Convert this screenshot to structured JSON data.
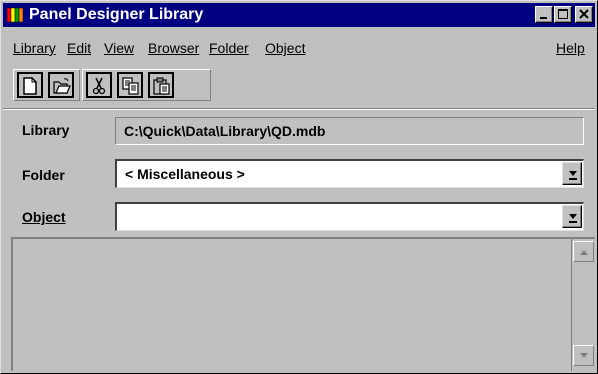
{
  "window": {
    "title": "Panel Designer Library",
    "titlebar_color": "#000080",
    "icon": "app-books-icon",
    "controls": [
      "minimize-icon",
      "maximize-icon",
      "close-icon"
    ]
  },
  "menu": {
    "items": [
      {
        "label": "Library"
      },
      {
        "label": "Edit"
      },
      {
        "label": "View"
      },
      {
        "label": "Browser"
      },
      {
        "label": "Folder"
      },
      {
        "label": "Object"
      }
    ],
    "help": "Help"
  },
  "toolbar": {
    "buttons": [
      {
        "icon": "new-document-icon"
      },
      {
        "icon": "open-folder-icon"
      },
      {
        "icon": "cut-icon"
      },
      {
        "icon": "copy-icon"
      },
      {
        "icon": "paste-icon"
      }
    ]
  },
  "form": {
    "library_label": "Library",
    "library_value": "C:\\Quick\\Data\\Library\\QD.mdb",
    "folder_label": "Folder",
    "folder_value": "< Miscellaneous >",
    "object_label": "Object",
    "object_value": ""
  }
}
